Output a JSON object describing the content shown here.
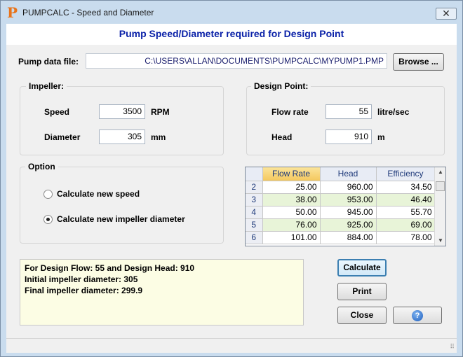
{
  "window": {
    "app_icon": "P",
    "title": "PUMPCALC - Speed and Diameter",
    "close_glyph": "✕"
  },
  "header": {
    "title": "Pump Speed/Diameter required for Design Point"
  },
  "datafile": {
    "label": "Pump data file:",
    "path": "C:\\USERS\\ALLAN\\DOCUMENTS\\PUMPCALC\\MYPUMP1.PMP",
    "browse_label": "Browse ..."
  },
  "impeller": {
    "title": "Impeller:",
    "speed_label": "Speed",
    "speed_value": "3500",
    "speed_unit": "RPM",
    "diameter_label": "Diameter",
    "diameter_value": "305",
    "diameter_unit": "mm"
  },
  "design_point": {
    "title": "Design Point:",
    "flow_label": "Flow rate",
    "flow_value": "55",
    "flow_unit": "litre/sec",
    "head_label": "Head",
    "head_value": "910",
    "head_unit": "m"
  },
  "option": {
    "title": "Option",
    "opt_speed": "Calculate new speed",
    "opt_diameter": "Calculate new impeller diameter",
    "selected": "diameter"
  },
  "grid": {
    "headers": [
      "Flow Rate",
      "Head",
      "Efficiency"
    ],
    "rows": [
      {
        "n": "2",
        "flow": "25.00",
        "head": "960.00",
        "eff": "34.50"
      },
      {
        "n": "3",
        "flow": "38.00",
        "head": "953.00",
        "eff": "46.40"
      },
      {
        "n": "4",
        "flow": "50.00",
        "head": "945.00",
        "eff": "55.70"
      },
      {
        "n": "5",
        "flow": "76.00",
        "head": "925.00",
        "eff": "69.00"
      },
      {
        "n": "6",
        "flow": "101.00",
        "head": "884.00",
        "eff": "78.00"
      }
    ]
  },
  "results": {
    "line1": "For Design Flow:  55  and  Design Head:  910",
    "line2": "Initial impeller diameter:  305",
    "line3": "Final impeller diameter:  299.9"
  },
  "buttons": {
    "calculate": "Calculate",
    "print": "Print",
    "close": "Close",
    "help_glyph": "?"
  },
  "colors": {
    "title_blue": "#0a21a8",
    "results_bg": "#fcfde4",
    "grid_alt_row": "#e8f4d8",
    "header_selected": "#f4c85e"
  }
}
